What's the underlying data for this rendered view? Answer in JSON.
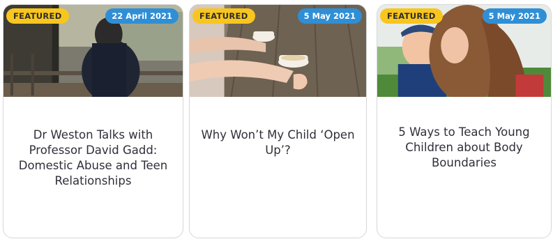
{
  "cards": [
    {
      "badge": "FEATURED",
      "date": "22 April 2021",
      "title": "Dr Weston Talks with Professor David Gadd: Domestic Abuse and Teen Relationships",
      "photo": "person-at-window-photo"
    },
    {
      "badge": "FEATURED",
      "date": "5 May 2021",
      "title": "Why Won’t My Child ‘Open Up’?",
      "photo": "hands-with-cups-on-table-photo"
    },
    {
      "badge": "FEATURED",
      "date": "5 May 2021",
      "title": "5 Ways to Teach Young Children about Body Boundaries",
      "photo": "mother-kissing-child-photo"
    }
  ],
  "colors": {
    "featured_badge": "#f8c61e",
    "date_badge": "#2f8fd6",
    "title_text": "#2f2f3a",
    "card_border": "#d6d6d6"
  }
}
